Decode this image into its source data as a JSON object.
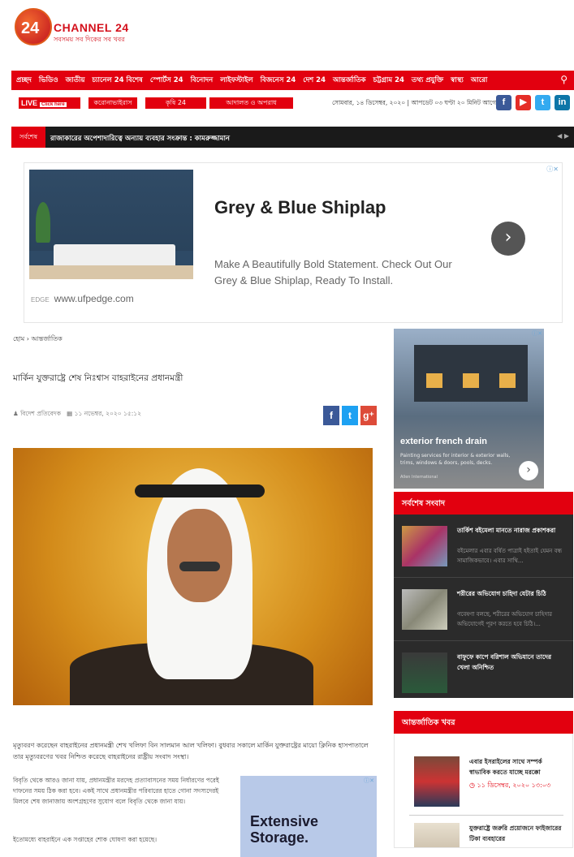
{
  "header": {
    "logo_number": "24",
    "logo_name": "CHANNEL 24",
    "logo_tagline": "সবসময় সব দিকের সব খবর"
  },
  "nav": {
    "items": [
      "প্রচ্ছদ",
      "ভিডিও",
      "জাতীয়",
      "চ্যানেল 24 বিশেষ",
      "স্পোর্টস 24",
      "বিনোদন",
      "লাইফস্টাইল",
      "বিজনেস 24",
      "দেশ 24",
      "আন্তর্জাতিক",
      "চট্টগ্রাম 24",
      "তথ্য প্রযুক্তি",
      "স্বাস্থ্য",
      "আরো"
    ],
    "search_icon": "search-icon"
  },
  "subnav": {
    "live_label": "LIVE",
    "click_here": "Click here",
    "cats": [
      "করোনাভাইরাস",
      "কৃষি 24",
      "আদালত ও অপরাধ"
    ],
    "date_text": "সোমবার, ১৪ ডিসেম্বর, ২০২০ | আপডেট ০৩ ঘণ্টা ২০ মিনিট আগে",
    "social": [
      "f",
      "▶",
      "t",
      "in"
    ],
    "social_colors": [
      "#3b5998",
      "#e52d27",
      "#33aaf0",
      "#0e76a8"
    ]
  },
  "breaking": {
    "label": "সর্বশেষ",
    "text": "রাজাকারের অপেশাদারিত্বে অন্যায় ব্যবহার সংক্রান্ত : কামরুজ্জামান",
    "arrows": "◀ ▶"
  },
  "ad1": {
    "title": "Grey & Blue Shiplap",
    "body": "Make A Beautifully Bold Statement. Check Out Our Grey & Blue Shiplap, Ready To Install.",
    "brand": "EDGE",
    "url": "www.ufpedge.com",
    "adchoice": "ⓘ✕",
    "cta": "›"
  },
  "article": {
    "breadcrumb": "হোম › আন্তর্জাতিক",
    "headline": "মার্কিন যুক্তরাষ্ট্রে শেষ নিঃশ্বাস বাহরাইনের প্রধানমন্ত্রী",
    "author": "বিদেশ প্রতিবেদক",
    "date": "১১ নভেম্বর, ২০২০ ১৫:১২",
    "share": [
      "f",
      "t",
      "g⁺"
    ],
    "share_colors": [
      "#3b5998",
      "#1da1f2",
      "#dd4b39"
    ],
    "lead": "মৃত্যুবরণ করেছেন বাহরাইনের প্রধানমন্ত্রী শেখ খলিফা বিন সালমান আল খলিফা। বুধবার সকালে মার্কিন যুক্তরাষ্ট্রের মায়ো ক্লিনিক হাসপাতালে তার মৃত্যুবরণের খবর নিশ্চিত করেছে বাহরাইনের রাষ্ট্রীয় সংবাদ সংস্থা।",
    "para2": "বিবৃতি থেকে আরও জানা যায়, প্রধানমন্ত্রীর মরদেহ প্রত্যাবাসনের সময় নির্ধারণের পরেই দাফনের সময় ঠিক করা হবে। একই সাথে প্রধানমন্ত্রীর পরিবারের হাতে গোনা সদস্যদেরই মিলবে শেষ জানাজায় অংশগ্রহণের সুযোগ বলে বিবৃতি থেকে জানা যায়।",
    "para3": "ইতোমধ্যে বাহরাইনে এক সপ্তাহের শোক ঘোষণা করা হয়েছে।"
  },
  "ad2": {
    "text": "Extensive Storage.",
    "adchoice": "ⓘ✕"
  },
  "ad3": {
    "title": "exterior french drain",
    "desc": "Painting services for interior & exterior walls, trims, windows & doors, pools, decks.",
    "source": "Allen International",
    "adchoice": "ⓘ✕",
    "cta": "›"
  },
  "latest": {
    "header": "সর্বশেষ সংবাদ",
    "items": [
      {
        "title": "তার্কিশ বইমেলা মানতে নারাজ প্রকাশকরা",
        "snippet": "বইমেলার এবার বর্ষিত পাত্রাই হইতাই যেমন বন্ধ সামাজিকভাবে। এবার সাথি..."
      },
      {
        "title": "শরীরের অভিযোগ চাহিদা যেটার চিঠি",
        "snippet": "গবেষণা বলছে, শরীরের অভিযোগ চাহিদার অভিযোগেই পূরণ করতে হবে চিঠি।..."
      },
      {
        "title": "বাফুফে কাপে বরিশাল অভিযানে তাদের খেলা অনিশ্চিত",
        "snippet": ""
      }
    ]
  },
  "intl": {
    "header": "আন্তর্জাতিক খবর",
    "items": [
      {
        "title": "এবার ইসরাইলের সাথে সম্পর্ক স্বাভাবিক করতে যাচ্ছে মরক্কো",
        "date": "◷ ১১ ডিসেম্বর, ২০২০ ১৩:০৩"
      },
      {
        "title": "যুক্তরাষ্ট্রে জরুরি প্রয়োজনে ফাইজারের টিকা ব্যবহারের",
        "date": ""
      }
    ]
  }
}
